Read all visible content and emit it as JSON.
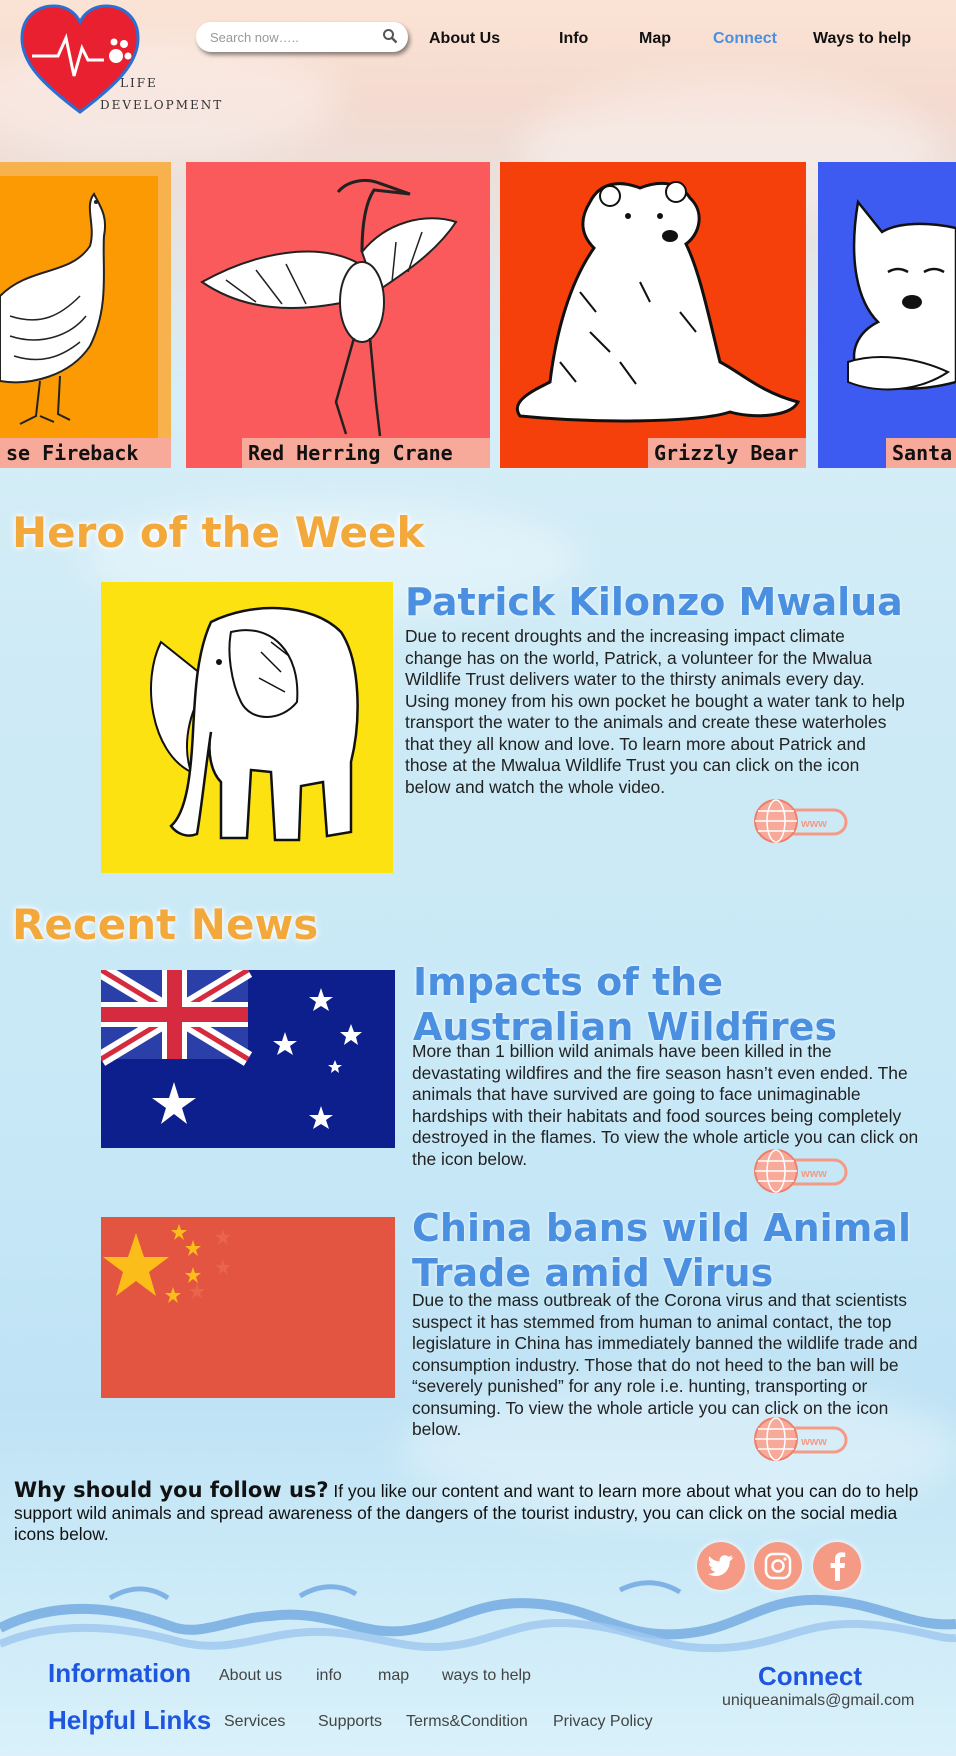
{
  "header": {
    "logo_text_line1": "LIFE",
    "logo_text_line2": "DEVELOPMENT",
    "search_placeholder": "Search now…..",
    "nav": [
      "About Us",
      "Info",
      "Map",
      "Connect",
      "Ways to help"
    ],
    "active_nav": "Connect",
    "colors": {
      "logo_red": "#e8202f",
      "logo_outline": "#2a6fd4",
      "active_nav": "#4a8fe0"
    }
  },
  "carousel": [
    {
      "label": "se Fireback",
      "bg": "#fb9a02",
      "frame": "#f7b24e",
      "icon": "pheasant-illustration"
    },
    {
      "label": "Red Herring Crane",
      "bg": "#fb5a5c",
      "icon": "crane-illustration"
    },
    {
      "label": "Grizzly Bear",
      "bg": "#f5400b",
      "icon": "bear-illustration"
    },
    {
      "label": "Santa",
      "bg": "#3e5bf1",
      "icon": "fox-illustration"
    }
  ],
  "hero": {
    "heading": "Hero of the Week",
    "title": "Patrick Kilonzo Mwalua",
    "body": "Due to recent droughts and the increasing impact climate change has on the world, Patrick, a volunteer for the Mwalua Wildlife Trust delivers water to the thirsty animals every day. Using money from his own pocket he bought a water tank to help transport the water to the animals and create these waterholes that they all know and love. To learn more about Patrick and those at the Mwalua Wildlife Trust you can click on the icon below and watch the whole video.",
    "image_bg": "#fde212",
    "icon": "elephant-illustration",
    "link_label": "www"
  },
  "news": {
    "heading": "Recent News",
    "articles": [
      {
        "title": "Impacts of the Australian Wildfires",
        "body": "More than 1 billion wild animals have been killed in the devastating wildfires and the fire season hasn’t even ended. The animals that have survived are going to face unimaginable hardships with their habitats and food sources being completely destroyed in the flames. To view the whole article you can click on the icon below.",
        "icon": "australia-flag",
        "link_label": "www"
      },
      {
        "title": "China bans wild Animal Trade amid Virus",
        "body": "Due to the mass outbreak of the Corona virus and that scientists suspect it has stemmed from human to animal contact, the top legislature in China has immediately banned the wildlife trade and consumption industry. Those that do not heed to the ban will be “severely punished” for any role i.e. hunting, transporting or consuming. To view the whole article you can click on the icon below.",
        "icon": "china-flag",
        "link_label": "www"
      }
    ]
  },
  "follow": {
    "lead": "Why should you follow us?",
    "text": " If you like our content and want to learn more about what you can do to help support wild animals and spread awareness of the dangers of the tourist industry, you can click on the social media icons below.",
    "social": [
      "twitter-icon",
      "instagram-icon",
      "facebook-icon"
    ],
    "social_color": "#f59a85"
  },
  "footer": {
    "information_heading": "Information",
    "information_links": [
      "About us",
      "info",
      "map",
      "ways to help"
    ],
    "helpful_heading": "Helpful Links",
    "helpful_links": [
      "Services",
      "Supports",
      "Terms&Condition",
      "Privacy Policy"
    ],
    "connect_heading": "Connect",
    "email": "uniqueanimals@gmail.com",
    "heading_color": "#1f56e0"
  }
}
